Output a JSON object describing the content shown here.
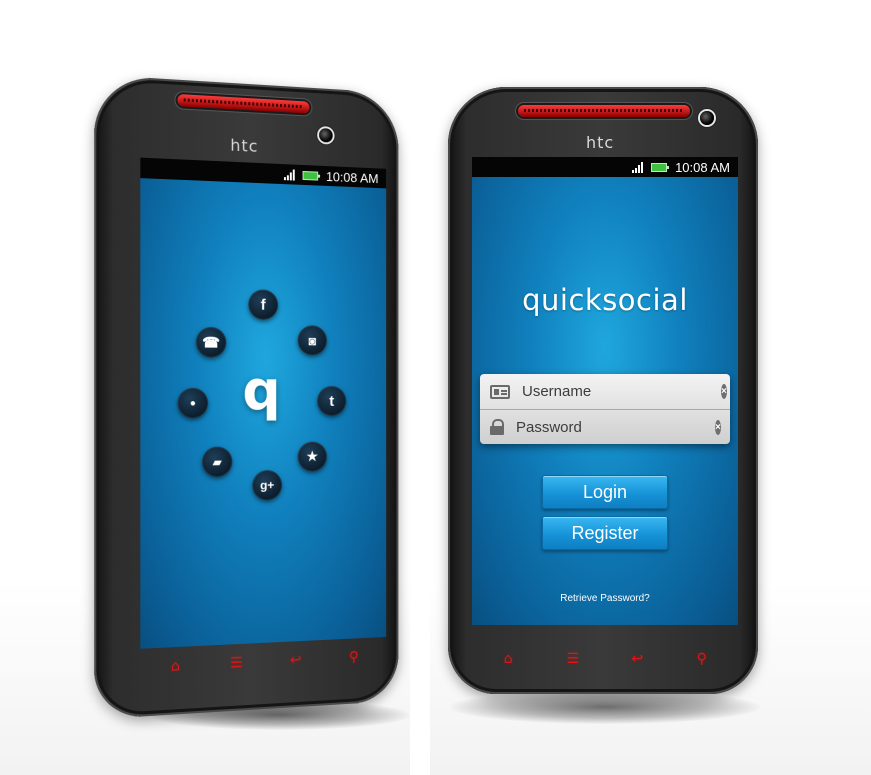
{
  "left_phone": {
    "brand": "htc",
    "status_bar": {
      "time": "10:08 AM",
      "signal_icon": "signal-icon",
      "battery_icon": "battery-icon"
    },
    "app_logo_glyph": "q",
    "social_icons": [
      {
        "name": "facebook",
        "glyph": "f"
      },
      {
        "name": "camera",
        "glyph": "◙"
      },
      {
        "name": "twitter",
        "glyph": "t"
      },
      {
        "name": "favorites",
        "glyph": "★"
      },
      {
        "name": "google-plus",
        "glyph": "g+"
      },
      {
        "name": "chat",
        "glyph": "▰"
      },
      {
        "name": "location",
        "glyph": "●"
      },
      {
        "name": "phone",
        "glyph": "☎"
      }
    ],
    "nav_keys": [
      {
        "name": "home",
        "glyph": "⌂"
      },
      {
        "name": "menu",
        "glyph": "☰"
      },
      {
        "name": "back",
        "glyph": "↩"
      },
      {
        "name": "search",
        "glyph": "⚲"
      }
    ]
  },
  "right_phone": {
    "brand": "htc",
    "status_bar": {
      "time": "10:08 AM",
      "signal_icon": "signal-icon",
      "battery_icon": "battery-icon"
    },
    "logo": "quicksocial",
    "login_form": {
      "username_placeholder": "Username",
      "password_placeholder": "Password",
      "clear_glyph": "×"
    },
    "login_button": "Login",
    "register_button": "Register",
    "retrieve_link": "Retrieve Password?",
    "nav_keys": [
      {
        "name": "home",
        "glyph": "⌂"
      },
      {
        "name": "menu",
        "glyph": "☰"
      },
      {
        "name": "back",
        "glyph": "↩"
      },
      {
        "name": "search",
        "glyph": "⚲"
      }
    ]
  },
  "colors": {
    "screen_blue": "#1080bd",
    "button_blue": "#1793d8",
    "nav_key_red": "#e01616",
    "battery_green": "#3fc13f"
  }
}
